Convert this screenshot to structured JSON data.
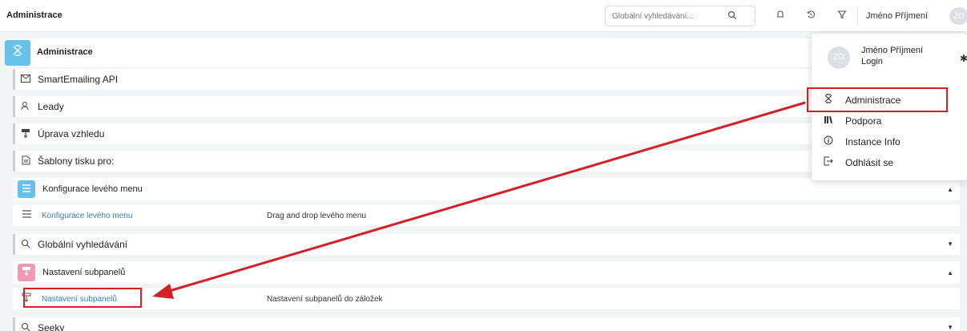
{
  "topbar": {
    "title": "Administrace",
    "search_placeholder": "Globální vyhledávání...",
    "user_name": "Jméno Příjmení",
    "avatar_initials": "ZO"
  },
  "admin": {
    "title": "Administrace"
  },
  "rows": [
    {
      "label": "SmartEmailing API",
      "icon": "envelope-icon"
    },
    {
      "label": "Leady",
      "icon": "user-icon"
    },
    {
      "label": "Úprava vzhledu",
      "icon": "paint-roller-icon"
    },
    {
      "label": "Šablony tisku pro:",
      "icon": "document-icon"
    }
  ],
  "sections": [
    {
      "label": "Konfigurace levého menu",
      "expanded": true,
      "color": "#66c2ea",
      "sub": {
        "link": "Konfigurace levého menu",
        "desc": "Drag and drop levého menu"
      }
    },
    {
      "label": "Globální vyhledávání",
      "expanded": false
    },
    {
      "label": "Nastavení subpanelů",
      "expanded": true,
      "color": "#f29ab3",
      "sub": {
        "link": "Nastavení subpanelů",
        "desc": "Nastavení subpanelů do záložek"
      }
    },
    {
      "label": "Seeky",
      "expanded": false
    }
  ],
  "dropdown": {
    "avatar_initials": "ZO",
    "name": "Jméno Příjmení",
    "login": "Login",
    "items": [
      {
        "label": "Administrace",
        "icon": "admin-icon"
      },
      {
        "label": "Podpora",
        "icon": "library-icon"
      },
      {
        "label": "Instance Info",
        "icon": "info-icon"
      },
      {
        "label": "Odhlásit se",
        "icon": "logout-icon"
      }
    ]
  },
  "annotation": {
    "color": "#d42027"
  }
}
